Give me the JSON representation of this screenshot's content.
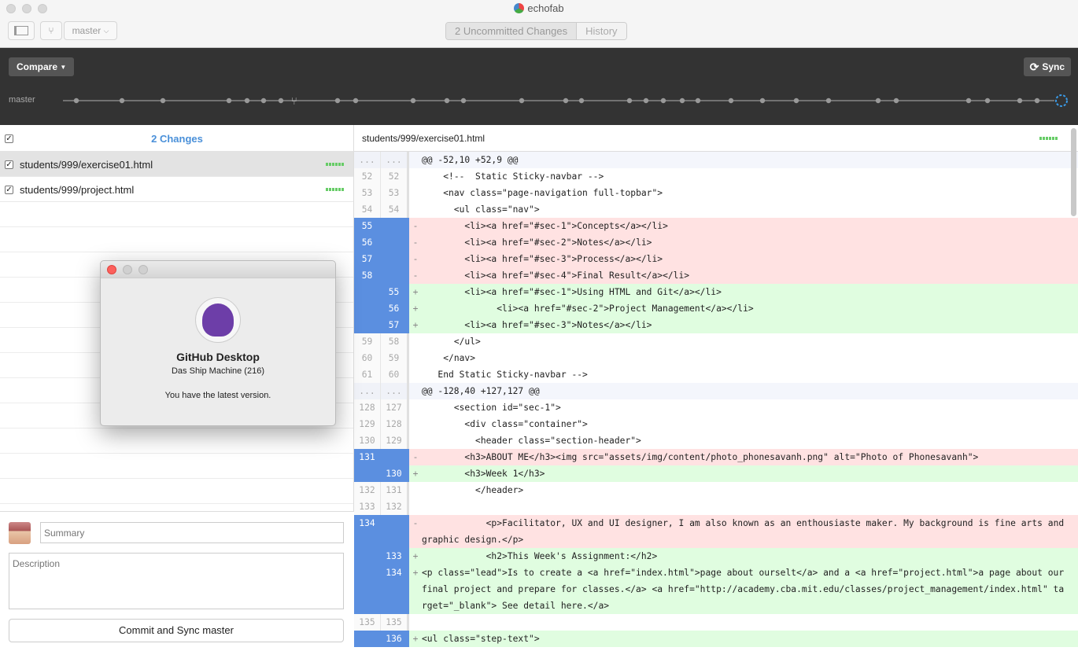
{
  "window": {
    "title": "echofab"
  },
  "toolbar": {
    "branch": "master",
    "tabs": [
      {
        "label": "2 Uncommitted Changes",
        "active": true
      },
      {
        "label": "History",
        "active": false
      }
    ]
  },
  "compare": {
    "compare_label": "Compare",
    "sync_label": "Sync",
    "branch_label": "master"
  },
  "sidebar": {
    "changes_title": "2 Changes",
    "files": [
      {
        "name": "students/999/exercise01.html",
        "selected": true
      },
      {
        "name": "students/999/project.html",
        "selected": false
      }
    ]
  },
  "commit": {
    "summary_placeholder": "Summary",
    "description_placeholder": "Description",
    "button_label": "Commit and Sync master"
  },
  "about": {
    "title": "GitHub Desktop",
    "version": "Das Ship Machine (216)",
    "message": "You have the latest version."
  },
  "diff": {
    "path": "students/999/exercise01.html",
    "lines": [
      {
        "type": "hunk",
        "old": "...",
        "new": "...",
        "text": "@@ -52,10 +52,9 @@"
      },
      {
        "type": "ctx",
        "old": "52",
        "new": "52",
        "text": "    <!--  Static Sticky-navbar -->"
      },
      {
        "type": "ctx",
        "old": "53",
        "new": "53",
        "text": "    <nav class=\"page-navigation full-topbar\">"
      },
      {
        "type": "ctx",
        "old": "54",
        "new": "54",
        "text": "      <ul class=\"nav\">"
      },
      {
        "type": "del",
        "old": "55",
        "new": "",
        "text": "        <li><a href=\"#sec-1\">Concepts</a></li>"
      },
      {
        "type": "del",
        "old": "56",
        "new": "",
        "text": "        <li><a href=\"#sec-2\">Notes</a></li>"
      },
      {
        "type": "del",
        "old": "57",
        "new": "",
        "text": "        <li><a href=\"#sec-3\">Process</a></li>"
      },
      {
        "type": "del",
        "old": "58",
        "new": "",
        "text": "        <li><a href=\"#sec-4\">Final Result</a></li>"
      },
      {
        "type": "add",
        "old": "",
        "new": "55",
        "text": "        <li><a href=\"#sec-1\">Using HTML and Git</a></li>"
      },
      {
        "type": "add",
        "old": "",
        "new": "56",
        "text": "              <li><a href=\"#sec-2\">Project Management</a></li>"
      },
      {
        "type": "add",
        "old": "",
        "new": "57",
        "text": "        <li><a href=\"#sec-3\">Notes</a></li>"
      },
      {
        "type": "ctx",
        "old": "59",
        "new": "58",
        "text": "      </ul>"
      },
      {
        "type": "ctx",
        "old": "60",
        "new": "59",
        "text": "    </nav>"
      },
      {
        "type": "ctx",
        "old": "61",
        "new": "60",
        "text": "   End Static Sticky-navbar -->"
      },
      {
        "type": "hunk",
        "old": "...",
        "new": "...",
        "text": "@@ -128,40 +127,127 @@"
      },
      {
        "type": "ctx",
        "old": "128",
        "new": "127",
        "text": "      <section id=\"sec-1\">"
      },
      {
        "type": "ctx",
        "old": "129",
        "new": "128",
        "text": "        <div class=\"container\">"
      },
      {
        "type": "ctx",
        "old": "130",
        "new": "129",
        "text": "          <header class=\"section-header\">"
      },
      {
        "type": "del",
        "old": "131",
        "new": "",
        "text": "        <h3>ABOUT ME</h3><img src=\"assets/img/content/photo_phonesavanh.png\" alt=\"Photo of Phonesavanh\">"
      },
      {
        "type": "add",
        "old": "",
        "new": "130",
        "text": "        <h3>Week 1</h3>"
      },
      {
        "type": "ctx",
        "old": "132",
        "new": "131",
        "text": "          </header>"
      },
      {
        "type": "ctx",
        "old": "133",
        "new": "132",
        "text": ""
      },
      {
        "type": "del",
        "old": "134",
        "new": "",
        "text": "            <p>Facilitator, UX and UI designer, I am also known as an enthousiaste maker. My background is fine arts and graphic design.</p>"
      },
      {
        "type": "add",
        "old": "",
        "new": "133",
        "text": "            <h2>This Week's Assignment:</h2>"
      },
      {
        "type": "add",
        "old": "",
        "new": "134",
        "text": "<p class=\"lead\">Is to create a <a href=\"index.html\">page about ourselt</a> and a <a href=\"project.html\">a page about our final project and prepare for classes.</a> <a href=\"http://academy.cba.mit.edu/classes/project_management/index.html\" target=\"_blank\"> See detail here.</a>"
      },
      {
        "type": "ctx",
        "old": "135",
        "new": "135",
        "text": ""
      },
      {
        "type": "add",
        "old": "",
        "new": "136",
        "text": "<ul class=\"step-text\">"
      }
    ]
  },
  "colors": {
    "accent": "#4a90d9",
    "gutter_changed": "#5b8fe0",
    "deleted": "#ffe2e2",
    "added": "#e0fde0"
  }
}
